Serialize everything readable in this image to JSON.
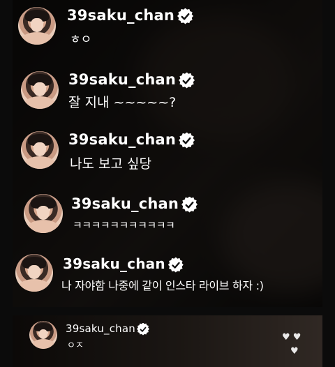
{
  "comments": [
    {
      "username": "39saku_chan",
      "message": "ㅎㅇ"
    },
    {
      "username": "39saku_chan",
      "message": "잘 지내 ~~~~~?"
    },
    {
      "username": "39saku_chan",
      "message": "나도 보고 싶당"
    },
    {
      "username": "39saku_chan",
      "message": "ㅋㅋㅋㅋㅋㅋㅋㅋㅋㅋㅋ"
    },
    {
      "username": "39saku_chan",
      "message": "나 자야함 나중에 같이 인스타 라이브 하자 :)"
    },
    {
      "username": "39saku_chan",
      "message": "ㅇㅈ"
    }
  ],
  "icons": {
    "verified": "verified-badge-icon",
    "hearts": "heart-icon"
  },
  "colors": {
    "text": "#ffffff",
    "overlay": "#000000",
    "background": "#0b0b0b"
  }
}
